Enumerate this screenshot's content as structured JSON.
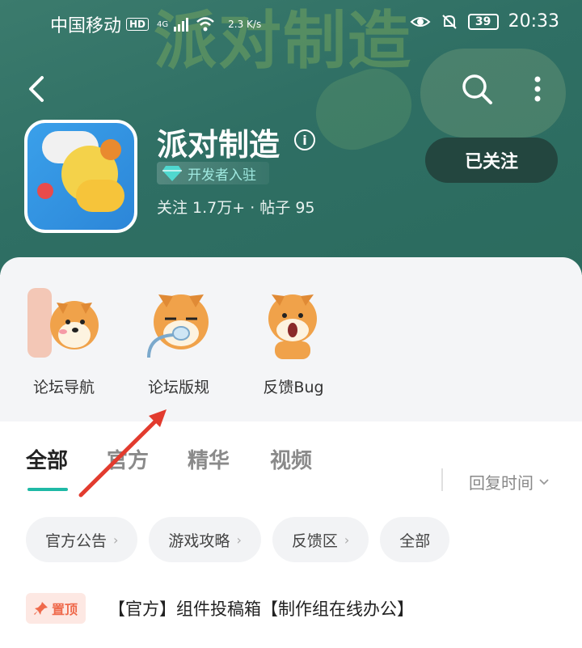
{
  "status_bar": {
    "carrier": "中国移动",
    "hd": "HD",
    "network": "4G",
    "speed": "2.3 K/s",
    "battery": "39",
    "time": "20:33"
  },
  "header": {
    "bg_text": "派对制造",
    "title": "派对制造",
    "developer_badge": "开发者入驻",
    "stats": "关注 1.7万+ · 帖子 95",
    "follow_label": "已关注"
  },
  "shortcuts": [
    {
      "label": "论坛导航"
    },
    {
      "label": "论坛版规"
    },
    {
      "label": "反馈Bug"
    }
  ],
  "tabs": [
    {
      "label": "全部",
      "active": true
    },
    {
      "label": "官方"
    },
    {
      "label": "精华"
    },
    {
      "label": "视频"
    }
  ],
  "sort": {
    "label": "回复时间"
  },
  "chips": [
    {
      "label": "官方公告",
      "chevron": true
    },
    {
      "label": "游戏攻略",
      "chevron": true
    },
    {
      "label": "反馈区",
      "chevron": true
    },
    {
      "label": "全部",
      "chevron": false
    }
  ],
  "pinned_post": {
    "badge": "置顶",
    "title": "【官方】组件投稿箱【制作组在线办公】"
  },
  "colors": {
    "accent": "#1fb9a6",
    "header_bg": "#2f6f64",
    "follow_btn": "#23463f",
    "pin_text": "#ef6a4c",
    "arrow": "#e23b2e"
  }
}
